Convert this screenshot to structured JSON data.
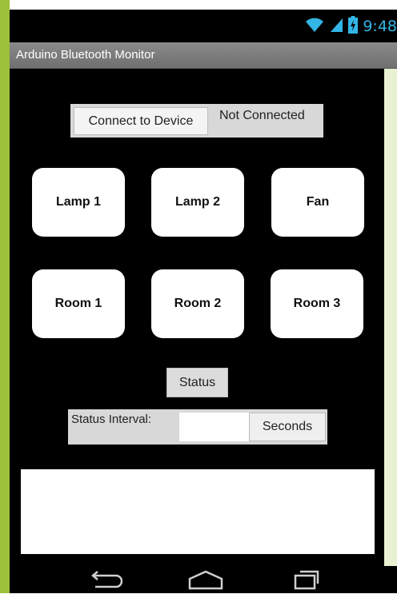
{
  "status_bar": {
    "time": "9:48",
    "icons": [
      "wifi-icon",
      "signal-icon",
      "battery-charging-icon"
    ],
    "icon_color": "#33b5e5"
  },
  "app": {
    "title": "Arduino Bluetooth Monitor"
  },
  "connection": {
    "connect_label": "Connect to Device",
    "status_text": "Not Connected"
  },
  "devices": [
    {
      "label": "Lamp 1"
    },
    {
      "label": "Lamp 2"
    },
    {
      "label": "Fan"
    },
    {
      "label": "Room 1"
    },
    {
      "label": "Room 2"
    },
    {
      "label": "Room 3"
    }
  ],
  "status": {
    "button_label": "Status",
    "interval_label": "Status Interval:",
    "interval_value": "",
    "seconds_label": "Seconds"
  },
  "output": {
    "text": ""
  },
  "nav": {
    "icons": [
      "back-icon",
      "home-icon",
      "recent-apps-icon"
    ]
  }
}
